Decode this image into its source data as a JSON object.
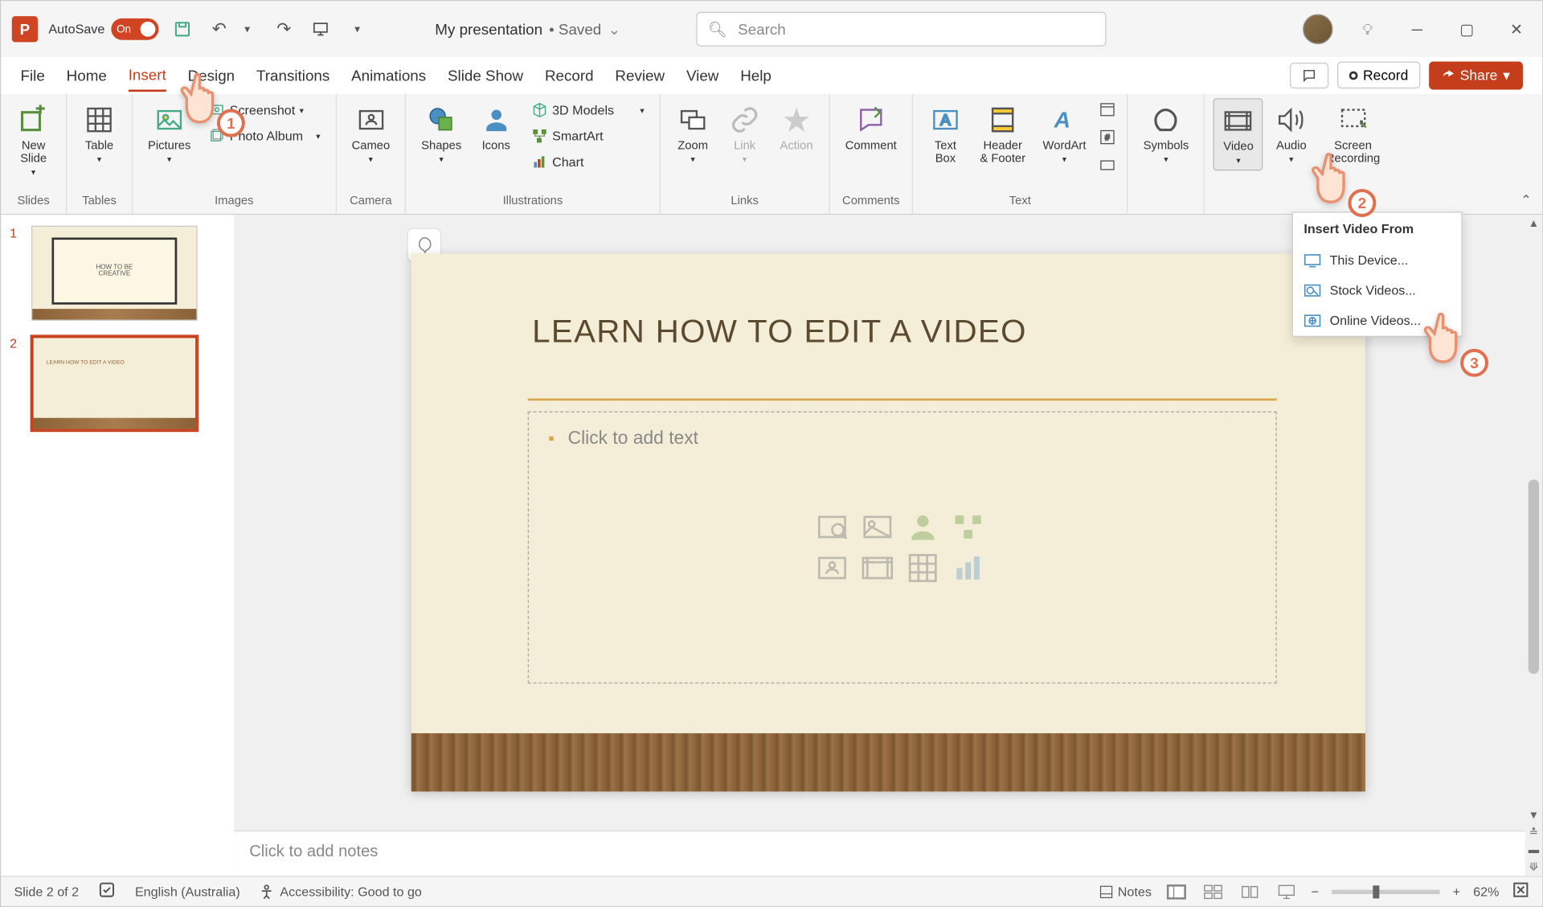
{
  "titlebar": {
    "autosave_label": "AutoSave",
    "autosave_state": "On",
    "doc_name": "My presentation",
    "doc_status": "• Saved",
    "search_placeholder": "Search"
  },
  "tabs": {
    "items": [
      "File",
      "Home",
      "Insert",
      "Design",
      "Transitions",
      "Animations",
      "Slide Show",
      "Record",
      "Review",
      "View",
      "Help"
    ],
    "active_index": 2,
    "record_label": "Record",
    "share_label": "Share"
  },
  "ribbon": {
    "groups": {
      "slides": {
        "label": "Slides",
        "new_slide": "New\nSlide"
      },
      "tables": {
        "label": "Tables",
        "table": "Table"
      },
      "images": {
        "label": "Images",
        "pictures": "Pictures",
        "screenshot": "Screenshot",
        "photo_album": "Photo Album"
      },
      "camera": {
        "label": "Camera",
        "cameo": "Cameo"
      },
      "illustrations": {
        "label": "Illustrations",
        "shapes": "Shapes",
        "icons": "Icons",
        "models": "3D Models",
        "smartart": "SmartArt",
        "chart": "Chart"
      },
      "links": {
        "label": "Links",
        "zoom": "Zoom",
        "link": "Link",
        "action": "Action"
      },
      "comments": {
        "label": "Comments",
        "comment": "Comment"
      },
      "text": {
        "label": "Text",
        "textbox": "Text\nBox",
        "header_footer": "Header\n& Footer",
        "wordart": "WordArt"
      },
      "symbols": {
        "label": "",
        "symbols": "Symbols"
      },
      "media": {
        "label": "",
        "video": "Video",
        "audio": "Audio",
        "screen_recording": "Screen\nRecording"
      }
    },
    "video_menu": {
      "header": "Insert Video From",
      "this_device": "This Device...",
      "stock_videos": "Stock Videos...",
      "online_videos": "Online Videos..."
    }
  },
  "thumbnails": {
    "slide1_title": "HOW TO BE\nCREATIVE",
    "slide2_title": "LEARN HOW TO EDIT A VIDEO"
  },
  "slide": {
    "title": "LEARN HOW TO EDIT A VIDEO",
    "placeholder": "Click to add text"
  },
  "notes": {
    "placeholder": "Click to add notes"
  },
  "statusbar": {
    "slide_info": "Slide 2 of 2",
    "language": "English (Australia)",
    "accessibility": "Accessibility: Good to go",
    "notes_label": "Notes",
    "zoom": "62%"
  },
  "cursors": {
    "badge1": "1",
    "badge2": "2",
    "badge3": "3"
  }
}
